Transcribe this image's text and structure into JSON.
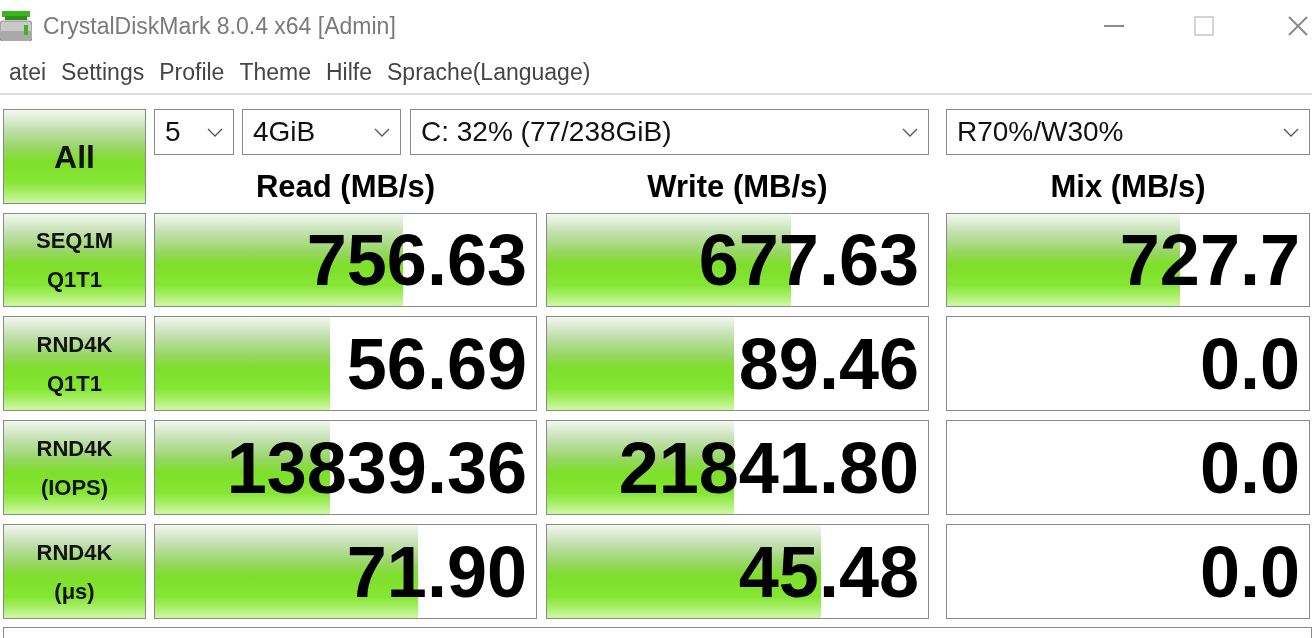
{
  "window": {
    "title": "CrystalDiskMark 8.0.4 x64 [Admin]"
  },
  "menu": [
    "atei",
    "Settings",
    "Profile",
    "Theme",
    "Hilfe",
    "Sprache(Language)"
  ],
  "all_button": "All",
  "dropdowns": [
    {
      "value": "5"
    },
    {
      "value": "4GiB"
    },
    {
      "value": "C: 32% (77/238GiB)"
    },
    {
      "value": "R70%/W30%"
    }
  ],
  "columns": [
    "Read (MB/s)",
    "Write (MB/s)",
    "Mix (MB/s)"
  ],
  "tests": [
    {
      "lines": [
        "SEQ1M",
        "Q1T1"
      ],
      "results": [
        {
          "value": "756.63",
          "level": 0.65
        },
        {
          "value": "677.63",
          "level": 0.64
        },
        {
          "value": "727.7",
          "level": 0.645
        }
      ]
    },
    {
      "lines": [
        "RND4K",
        "Q1T1"
      ],
      "results": [
        {
          "value": "56.69",
          "level": 0.46
        },
        {
          "value": "89.46",
          "level": 0.49
        },
        {
          "value": "0.0"
        }
      ]
    },
    {
      "lines": [
        "RND4K",
        "(IOPS)"
      ],
      "results": [
        {
          "value": "13839.36",
          "level": 0.46
        },
        {
          "value": "21841.80",
          "level": 0.49
        },
        {
          "value": "0.0"
        }
      ]
    },
    {
      "lines": [
        "RND4K",
        "(μs)"
      ],
      "results": [
        {
          "value": "71.90",
          "level": 0.69
        },
        {
          "value": "45.48",
          "level": 0.72
        },
        {
          "value": "0.0"
        }
      ]
    }
  ]
}
